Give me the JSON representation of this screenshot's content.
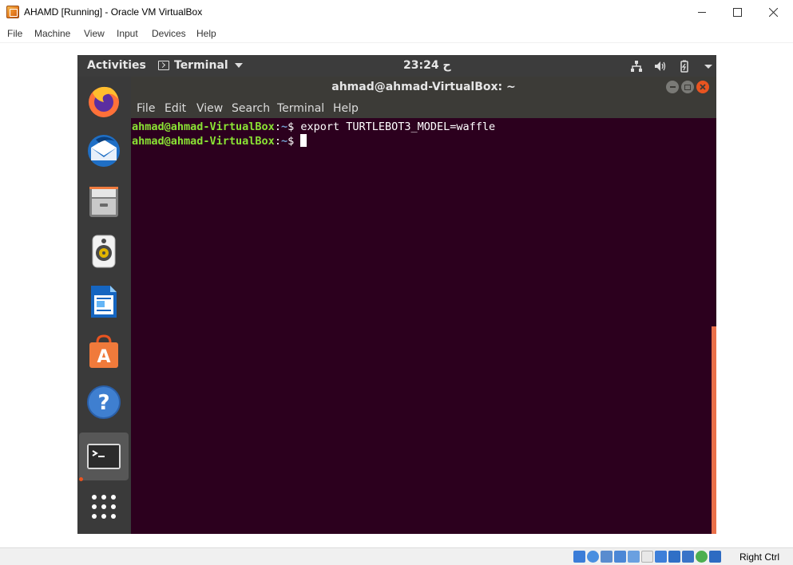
{
  "window": {
    "title": "AHAMD [Running] - Oracle VM VirtualBox",
    "menu": [
      "File",
      "Machine",
      "View",
      "Input",
      "Devices",
      "Help"
    ]
  },
  "guest_topbar": {
    "activities": "Activities",
    "app_name": "Terminal",
    "clock": "23:24 ح"
  },
  "dock": {
    "items": [
      "firefox-icon",
      "thunderbird-icon",
      "files-icon",
      "rhythmbox-icon",
      "libreoffice-writer-icon",
      "ubuntu-software-icon",
      "help-icon",
      "terminal-icon",
      "show-apps-icon"
    ],
    "active": "terminal-icon"
  },
  "terminal": {
    "title": "ahmad@ahmad-VirtualBox: ~",
    "menu": [
      "File",
      "Edit",
      "View",
      "Search",
      "Terminal",
      "Help"
    ],
    "lines": [
      {
        "user": "ahmad@ahmad-VirtualBox",
        "sep": ":",
        "path": "~",
        "symbol": "$ ",
        "command": "export TURTLEBOT3_MODEL=waffle"
      },
      {
        "user": "ahmad@ahmad-VirtualBox",
        "sep": ":",
        "path": "~",
        "symbol": "$ ",
        "command": ""
      }
    ]
  },
  "statusbar": {
    "host_key": "Right Ctrl"
  },
  "colors": {
    "terminal_bg": "#2c001e",
    "prompt_user": "#8ae234",
    "prompt_path": "#729fcf",
    "accent": "#e95420"
  }
}
